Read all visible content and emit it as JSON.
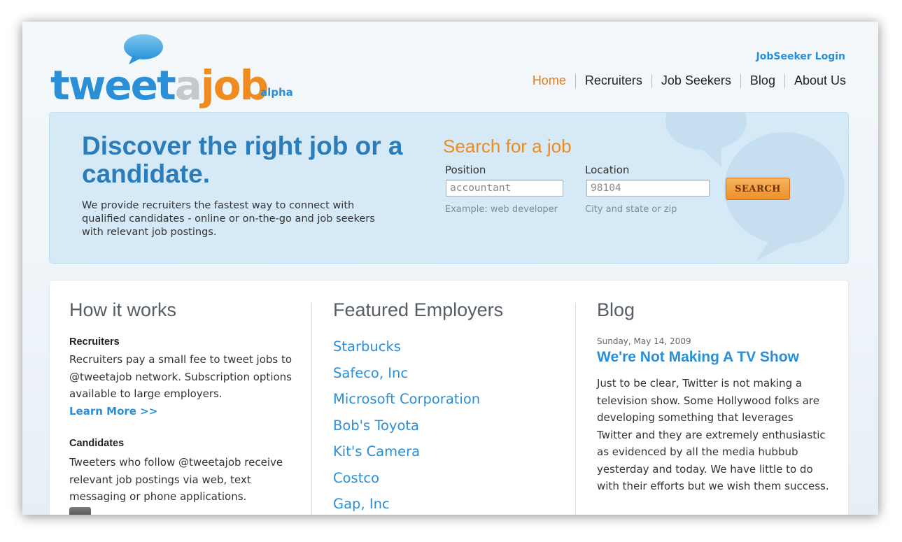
{
  "logo": {
    "part_tweet": "tweet",
    "part_a": "a",
    "part_job": "job",
    "alpha": "alpha",
    "colors": {
      "tweet": "#2a8fd6",
      "a": "#c4c9cd",
      "job": "#ef8b1f"
    }
  },
  "header": {
    "login_label": "JobSeeker Login",
    "nav": {
      "home": "Home",
      "recruiters": "Recruiters",
      "job_seekers": "Job Seekers",
      "blog": "Blog",
      "about_us": "About Us"
    },
    "active_item": "Home"
  },
  "hero": {
    "title": "Discover the right job or a candidate.",
    "description": "We provide recruiters the fastest way to connect with qualified candidates - online or on-the-go and job seekers with relevant job postings."
  },
  "search": {
    "heading": "Search for a job",
    "position_label": "Position",
    "position_value": "accountant",
    "position_hint": "Example: web developer",
    "location_label": "Location",
    "location_value": "98104",
    "location_hint": "City and state or zip",
    "button_label": "SEARCH"
  },
  "how_it_works": {
    "heading": "How it works",
    "recruiters_heading": "Recruiters",
    "recruiters_text": "Recruiters pay a small fee to tweet jobs to @tweetajob network. Subscription options available to large employers.",
    "learn_more": "Learn More >>",
    "candidates_heading": "Candidates",
    "candidates_text": "Tweeters who follow @tweetajob receive relevant job postings via web, text messaging or phone applications."
  },
  "featured_employers": {
    "heading": "Featured Employers",
    "items": [
      "Starbucks",
      "Safeco, Inc",
      "Microsoft Corporation",
      "Bob's Toyota",
      "Kit's Camera",
      "Costco",
      "Gap, Inc"
    ]
  },
  "blog": {
    "heading": "Blog",
    "date": "Sunday, May 14, 2009",
    "post_title": "We're Not Making A TV Show",
    "post_excerpt": "Just to be clear, Twitter is not making a television show. Some Hollywood folks are developing something that leverages Twitter and they are extremely enthusiastic as evidenced by all the media hubbub yesterday and today. We have little to do with their efforts but we wish them success."
  },
  "colors": {
    "accent_blue": "#2a8fd6",
    "accent_orange": "#ef8b1f",
    "hero_background": "#d5e9f6"
  }
}
